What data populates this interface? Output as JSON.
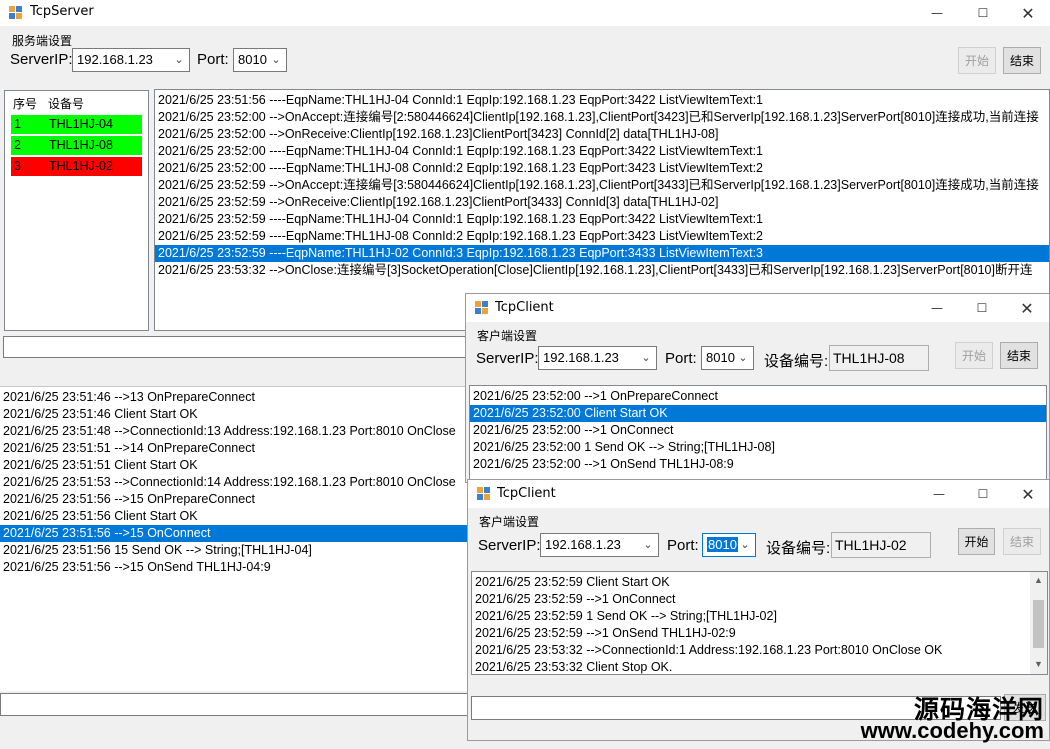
{
  "server": {
    "title": "TcpServer",
    "group_label": "服务端设置",
    "ip_label": "ServerIP:",
    "ip_value": "192.168.1.23",
    "port_label": "Port:",
    "port_value": "8010",
    "start_label": "开始",
    "stop_label": "结束",
    "listview": {
      "col_index": "序号",
      "col_device": "设备号",
      "rows": [
        {
          "index": "1",
          "device": "THL1HJ-04",
          "color": "#00ff00"
        },
        {
          "index": "2",
          "device": "THL1HJ-08",
          "color": "#00ff00"
        },
        {
          "index": "3",
          "device": "THL1HJ-02",
          "color": "#ff0000"
        }
      ]
    },
    "log": [
      "2021/6/25 23:51:56 ----EqpName:THL1HJ-04 ConnId:1 EqpIp:192.168.1.23 EqpPort:3422 ListViewItemText:1",
      "2021/6/25 23:52:00 -->OnAccept:连接编号[2:580446624]ClientIp[192.168.1.23],ClientPort[3423]已和ServerIp[192.168.1.23]ServerPort[8010]连接成功,当前连接",
      "2021/6/25 23:52:00 -->OnReceive:ClientIp[192.168.1.23]ClientPort[3423] ConnId[2] data[THL1HJ-08]",
      "2021/6/25 23:52:00 ----EqpName:THL1HJ-04 ConnId:1 EqpIp:192.168.1.23 EqpPort:3422 ListViewItemText:1",
      "2021/6/25 23:52:00 ----EqpName:THL1HJ-08 ConnId:2 EqpIp:192.168.1.23 EqpPort:3423 ListViewItemText:2",
      "2021/6/25 23:52:59 -->OnAccept:连接编号[3:580446624]ClientIp[192.168.1.23],ClientPort[3433]已和ServerIp[192.168.1.23]ServerPort[8010]连接成功,当前连接",
      "2021/6/25 23:52:59 -->OnReceive:ClientIp[192.168.1.23]ClientPort[3433] ConnId[3] data[THL1HJ-02]",
      "2021/6/25 23:52:59 ----EqpName:THL1HJ-04 ConnId:1 EqpIp:192.168.1.23 EqpPort:3422 ListViewItemText:1",
      "2021/6/25 23:52:59 ----EqpName:THL1HJ-08 ConnId:2 EqpIp:192.168.1.23 EqpPort:3423 ListViewItemText:2",
      "2021/6/25 23:52:59 ----EqpName:THL1HJ-02 ConnId:3 EqpIp:192.168.1.23 EqpPort:3433 ListViewItemText:3",
      "2021/6/25 23:53:32 -->OnClose:连接编号[3]SocketOperation[Close]ClientIp[192.168.1.23],ClientPort[3433]已和ServerIp[192.168.1.23]ServerPort[8010]断开连"
    ],
    "selected_log_index": 9
  },
  "background_client": {
    "log": [
      "2021/6/25 23:51:46 -->13 OnPrepareConnect",
      "2021/6/25 23:51:46 Client Start OK",
      "2021/6/25 23:51:48 -->ConnectionId:13 Address:192.168.1.23 Port:8010 OnClose",
      "2021/6/25 23:51:51 -->14 OnPrepareConnect",
      "2021/6/25 23:51:51 Client Start OK",
      "2021/6/25 23:51:53 -->ConnectionId:14 Address:192.168.1.23 Port:8010 OnClose",
      "2021/6/25 23:51:56 -->15 OnPrepareConnect",
      "2021/6/25 23:51:56 Client Start OK",
      "2021/6/25 23:51:56 -->15 OnConnect",
      "2021/6/25 23:51:56 15 Send OK --> String;[THL1HJ-04]",
      "2021/6/25 23:51:56 -->15 OnSend THL1HJ-04:9"
    ],
    "selected_log_index": 8
  },
  "client1": {
    "title": "TcpClient",
    "group_label": "客户端设置",
    "ip_label": "ServerIP:",
    "ip_value": "192.168.1.23",
    "port_label": "Port:",
    "port_value": "8010",
    "device_label": "设备编号:",
    "device_value": "THL1HJ-08",
    "start_label": "开始",
    "stop_label": "结束",
    "log": [
      "2021/6/25 23:52:00 -->1 OnPrepareConnect",
      "2021/6/25 23:52:00 Client Start OK",
      "2021/6/25 23:52:00 -->1 OnConnect",
      "2021/6/25 23:52:00 1 Send OK --> String;[THL1HJ-08]",
      "2021/6/25 23:52:00 -->1 OnSend THL1HJ-08:9"
    ],
    "selected_log_index": 1
  },
  "client2": {
    "title": "TcpClient",
    "group_label": "客户端设置",
    "ip_label": "ServerIP:",
    "ip_value": "192.168.1.23",
    "port_label": "Port:",
    "port_value": "8010",
    "device_label": "设备编号:",
    "device_value": "THL1HJ-02",
    "start_label": "开始",
    "stop_label": "结束",
    "send_label": "发送",
    "log": [
      "2021/6/25 23:52:59 Client Start OK",
      "2021/6/25 23:52:59 -->1 OnConnect",
      "2021/6/25 23:52:59 1 Send OK --> String;[THL1HJ-02]",
      "2021/6/25 23:52:59 -->1 OnSend THL1HJ-02:9",
      "2021/6/25 23:53:32 -->ConnectionId:1 Address:192.168.1.23 Port:8010 OnClose OK",
      "2021/6/25 23:53:32 Client Stop OK."
    ]
  },
  "watermark": {
    "line1": "源码海洋网",
    "line2": "www.codehy.com"
  },
  "colors": {
    "selection": "#0078d7",
    "online": "#00ff00",
    "offline": "#ff0000"
  }
}
